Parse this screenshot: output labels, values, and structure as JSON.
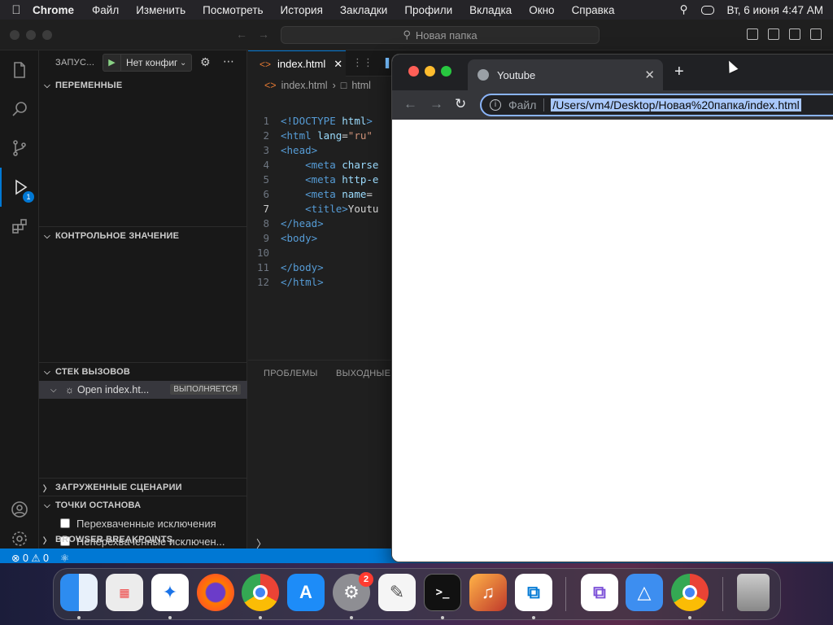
{
  "menubar": {
    "app_name": "Chrome",
    "items": [
      "Файл",
      "Изменить",
      "Посмотреть",
      "История",
      "Закладки",
      "Профили",
      "Вкладка",
      "Окно",
      "Справка"
    ],
    "datetime": "Вт, 6 июня  4:47 AM"
  },
  "vscode": {
    "command_center": "Новая папка",
    "run_title": "ЗАПУС...",
    "run_config": "Нет конфиг",
    "sections": {
      "variables": "ПЕРЕМЕННЫЕ",
      "watch": "КОНТРОЛЬНОЕ ЗНАЧЕНИЕ",
      "callstack": "СТЕК ВЫЗОВОВ",
      "loaded_scripts": "ЗАГРУЖЕННЫЕ СЦЕНАРИИ",
      "breakpoints": "ТОЧКИ ОСТАНОВА",
      "browser_breakpoints": "BROWSER BREAKPOINTS"
    },
    "callstack_item": "Open index.ht...",
    "callstack_status": "ВЫПОЛНЯЕТСЯ",
    "breakpoint_items": [
      "Перехваченные исключения",
      "Неперехваченные исключен..."
    ],
    "activity_badge": "1",
    "tab_label": "index.html",
    "breadcrumb": [
      "index.html",
      "html"
    ],
    "code_lines": [
      {
        "n": "1",
        "parts": [
          [
            "txt",
            "<!DOCTYPE "
          ],
          [
            "attr",
            "html"
          ],
          [
            "txt",
            ">"
          ]
        ]
      },
      {
        "n": "2",
        "parts": [
          [
            "txt",
            "<html "
          ],
          [
            "attr",
            "lang"
          ],
          [
            "plain",
            "="
          ],
          [
            "str",
            "\"ru\""
          ]
        ]
      },
      {
        "n": "3",
        "parts": [
          [
            "txt",
            "<head>"
          ]
        ]
      },
      {
        "n": "4",
        "parts": [
          [
            "plain",
            "    "
          ],
          [
            "txt",
            "<meta "
          ],
          [
            "attr",
            "charse"
          ]
        ]
      },
      {
        "n": "5",
        "parts": [
          [
            "plain",
            "    "
          ],
          [
            "txt",
            "<meta "
          ],
          [
            "attr",
            "http-e"
          ]
        ]
      },
      {
        "n": "6",
        "parts": [
          [
            "plain",
            "    "
          ],
          [
            "txt",
            "<meta "
          ],
          [
            "attr",
            "name"
          ],
          [
            "plain",
            "="
          ]
        ]
      },
      {
        "n": "7",
        "parts": [
          [
            "plain",
            "    "
          ],
          [
            "txt",
            "<title>"
          ],
          [
            "plain",
            "Youtu"
          ]
        ]
      },
      {
        "n": "8",
        "parts": [
          [
            "txt",
            "</head>"
          ]
        ]
      },
      {
        "n": "9",
        "parts": [
          [
            "txt",
            "<body>"
          ]
        ]
      },
      {
        "n": "10",
        "parts": [
          [
            "plain",
            ""
          ]
        ]
      },
      {
        "n": "11",
        "parts": [
          [
            "txt",
            "</body>"
          ]
        ]
      },
      {
        "n": "12",
        "parts": [
          [
            "txt",
            "</html>"
          ]
        ]
      }
    ],
    "current_line": "7",
    "panel_tabs": [
      "ПРОБЛЕМЫ",
      "ВЫХОДНЫЕ"
    ],
    "status": {
      "problems": "⊗ 0 ⚠ 0"
    }
  },
  "chrome": {
    "tab_title": "Youtube",
    "scheme_label": "Файл",
    "url": "/Users/vm4/Desktop/Новая%20папка/index.html"
  },
  "dock": {
    "settings_badge": "2"
  },
  "colors": {
    "accent": "#0078d4",
    "status_bar": "#0078d4",
    "omnibox_focus": "#8ab4f8"
  }
}
